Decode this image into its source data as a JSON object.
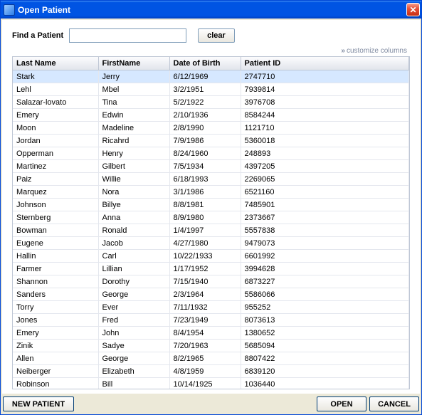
{
  "window": {
    "title": "Open Patient"
  },
  "search": {
    "label": "Find a Patient",
    "value": "",
    "clear_label": "clear"
  },
  "customize_label": "customize columns",
  "columns": {
    "last": "Last Name",
    "first": "FirstName",
    "dob": "Date of Birth",
    "pid": "Patient ID"
  },
  "rows": [
    {
      "last": "Stark",
      "first": "Jerry",
      "dob": "6/12/1969",
      "pid": "2747710",
      "selected": true
    },
    {
      "last": "Lehl",
      "first": "Mbel",
      "dob": "3/2/1951",
      "pid": "7939814"
    },
    {
      "last": "Salazar-lovato",
      "first": "Tina",
      "dob": "5/2/1922",
      "pid": "3976708"
    },
    {
      "last": "Emery",
      "first": "Edwin",
      "dob": "2/10/1936",
      "pid": "8584244"
    },
    {
      "last": "Moon",
      "first": "Madeline",
      "dob": "2/8/1990",
      "pid": "1121710"
    },
    {
      "last": "Jordan",
      "first": "Ricahrd",
      "dob": "7/9/1986",
      "pid": "5360018"
    },
    {
      "last": "Opperman",
      "first": "Henry",
      "dob": "8/24/1960",
      "pid": "248893"
    },
    {
      "last": "Martinez",
      "first": "Gilbert",
      "dob": "7/5/1934",
      "pid": "4397205"
    },
    {
      "last": "Paiz",
      "first": "Willie",
      "dob": "6/18/1993",
      "pid": "2269065"
    },
    {
      "last": "Marquez",
      "first": "Nora",
      "dob": "3/1/1986",
      "pid": "6521160"
    },
    {
      "last": "Johnson",
      "first": "Billye",
      "dob": "8/8/1981",
      "pid": "7485901"
    },
    {
      "last": "Sternberg",
      "first": "Anna",
      "dob": "8/9/1980",
      "pid": "2373667"
    },
    {
      "last": "Bowman",
      "first": "Ronald",
      "dob": "1/4/1997",
      "pid": "5557838"
    },
    {
      "last": "Eugene",
      "first": "Jacob",
      "dob": "4/27/1980",
      "pid": "9479073"
    },
    {
      "last": "Hallin",
      "first": "Carl",
      "dob": "10/22/1933",
      "pid": "6601992"
    },
    {
      "last": "Farmer",
      "first": "Lillian",
      "dob": "1/17/1952",
      "pid": "3994628"
    },
    {
      "last": "Shannon",
      "first": "Dorothy",
      "dob": "7/15/1940",
      "pid": "6873227"
    },
    {
      "last": "Sanders",
      "first": "George",
      "dob": "2/3/1964",
      "pid": "5586066"
    },
    {
      "last": "Torry",
      "first": "Ever",
      "dob": "7/11/1932",
      "pid": "955252"
    },
    {
      "last": "Jones",
      "first": "Fred",
      "dob": "7/23/1949",
      "pid": "8073613"
    },
    {
      "last": "Emery",
      "first": "John",
      "dob": "8/4/1954",
      "pid": "1380652"
    },
    {
      "last": "Zinik",
      "first": "Sadye",
      "dob": "7/20/1963",
      "pid": "5685094"
    },
    {
      "last": "Allen",
      "first": "George",
      "dob": "8/2/1965",
      "pid": "8807422"
    },
    {
      "last": "Neiberger",
      "first": "Elizabeth",
      "dob": "4/8/1959",
      "pid": "6839120"
    },
    {
      "last": "Robinson",
      "first": "Bill",
      "dob": "10/14/1925",
      "pid": "1036440"
    }
  ],
  "footer": {
    "new_patient": "NEW PATIENT",
    "open": "OPEN",
    "cancel": "CANCEL"
  }
}
